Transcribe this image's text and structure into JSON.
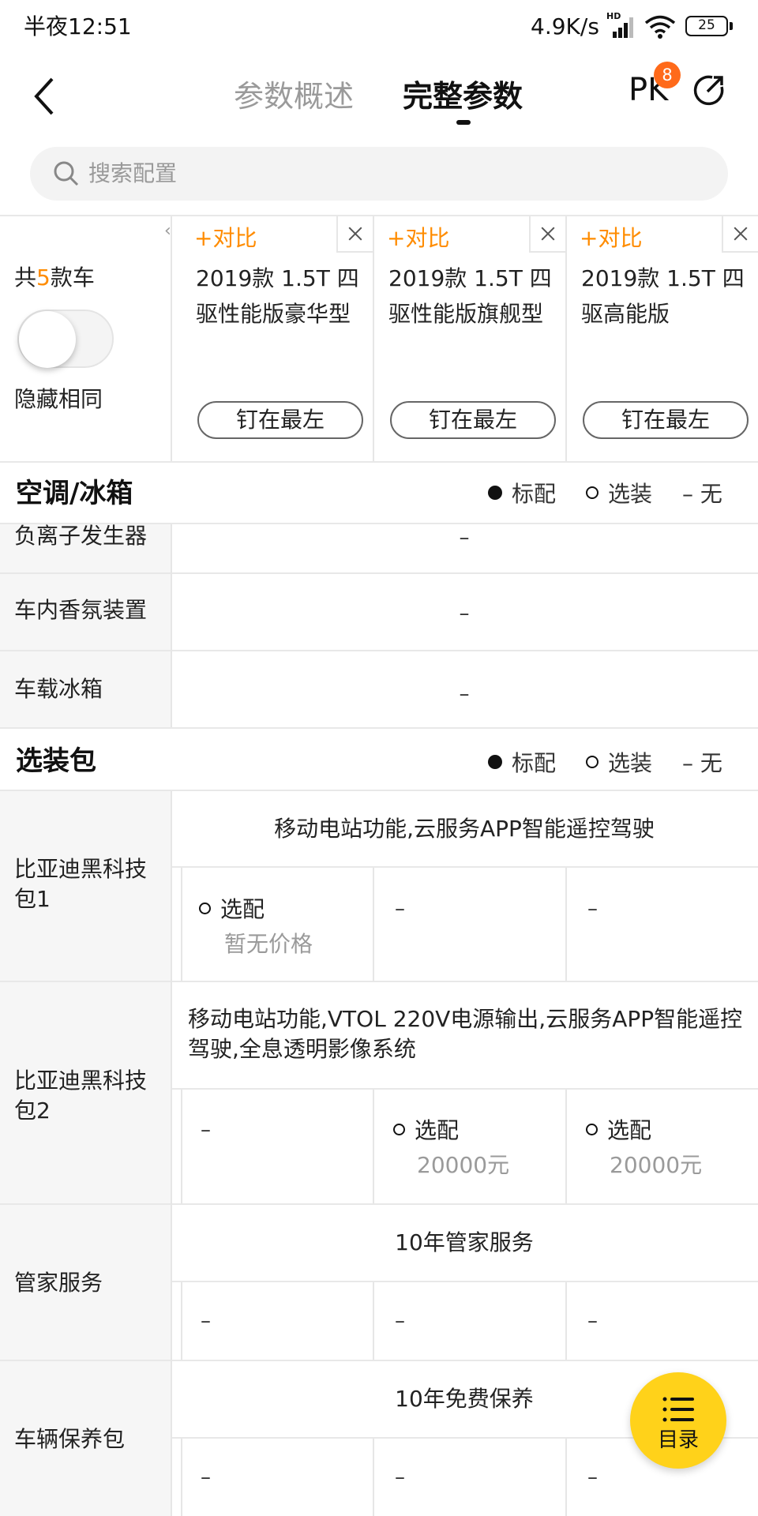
{
  "status": {
    "time": "半夜12:51",
    "speed": "4.9K/s",
    "hd": "HD",
    "battery": "25"
  },
  "nav": {
    "tab_overview": "参数概述",
    "tab_full": "完整参数",
    "pk": "PK",
    "pk_badge": "8"
  },
  "search": {
    "placeholder": "搜索配置"
  },
  "cars": {
    "count_prefix": "共",
    "count": "5",
    "count_suffix": "款车",
    "hide_same": "隐藏相同",
    "columns": [
      {
        "add": "+对比",
        "name": "2019款 1.5T 四驱性能版豪华型",
        "pin": "钉在最左"
      },
      {
        "add": "+对比",
        "name": "2019款 1.5T 四驱性能版旗舰型",
        "pin": "钉在最左"
      },
      {
        "add": "+对比",
        "name": "2019款 1.5T 四驱高能版",
        "pin": "钉在最左"
      }
    ]
  },
  "legend": {
    "standard": "标配",
    "optional": "选装",
    "none": "– 无"
  },
  "section_ac": {
    "title": "空调/冰箱",
    "rows": [
      {
        "label": "负离子发生器",
        "value": "–"
      },
      {
        "label": "车内香氛装置",
        "value": "–"
      },
      {
        "label": "车载冰箱",
        "value": "–"
      }
    ]
  },
  "section_pkg": {
    "title": "选装包",
    "rows": [
      {
        "label": "比亚迪黑科技包1",
        "desc": "移动电站功能,云服务APP智能遥控驾驶",
        "cells": [
          {
            "opt": "选配",
            "price": "暂无价格"
          },
          {
            "dash": "–"
          },
          {
            "dash": "–"
          }
        ]
      },
      {
        "label": "比亚迪黑科技包2",
        "desc": "移动电站功能,VTOL 220V电源输出,云服务APP智能遥控驾驶,全息透明影像系统",
        "cells": [
          {
            "dash": "–"
          },
          {
            "opt": "选配",
            "price": "20000元"
          },
          {
            "opt": "选配",
            "price": "20000元"
          }
        ]
      },
      {
        "label": "管家服务",
        "desc": "10年管家服务",
        "cells": [
          {
            "dash": "–"
          },
          {
            "dash": "–"
          },
          {
            "dash": "–"
          }
        ]
      },
      {
        "label": "车辆保养包",
        "desc": "10年免费保养",
        "cells": [
          {
            "dash": "–"
          },
          {
            "dash": "–"
          },
          {
            "dash": "–"
          }
        ]
      }
    ]
  },
  "fab": {
    "label": "目录"
  }
}
